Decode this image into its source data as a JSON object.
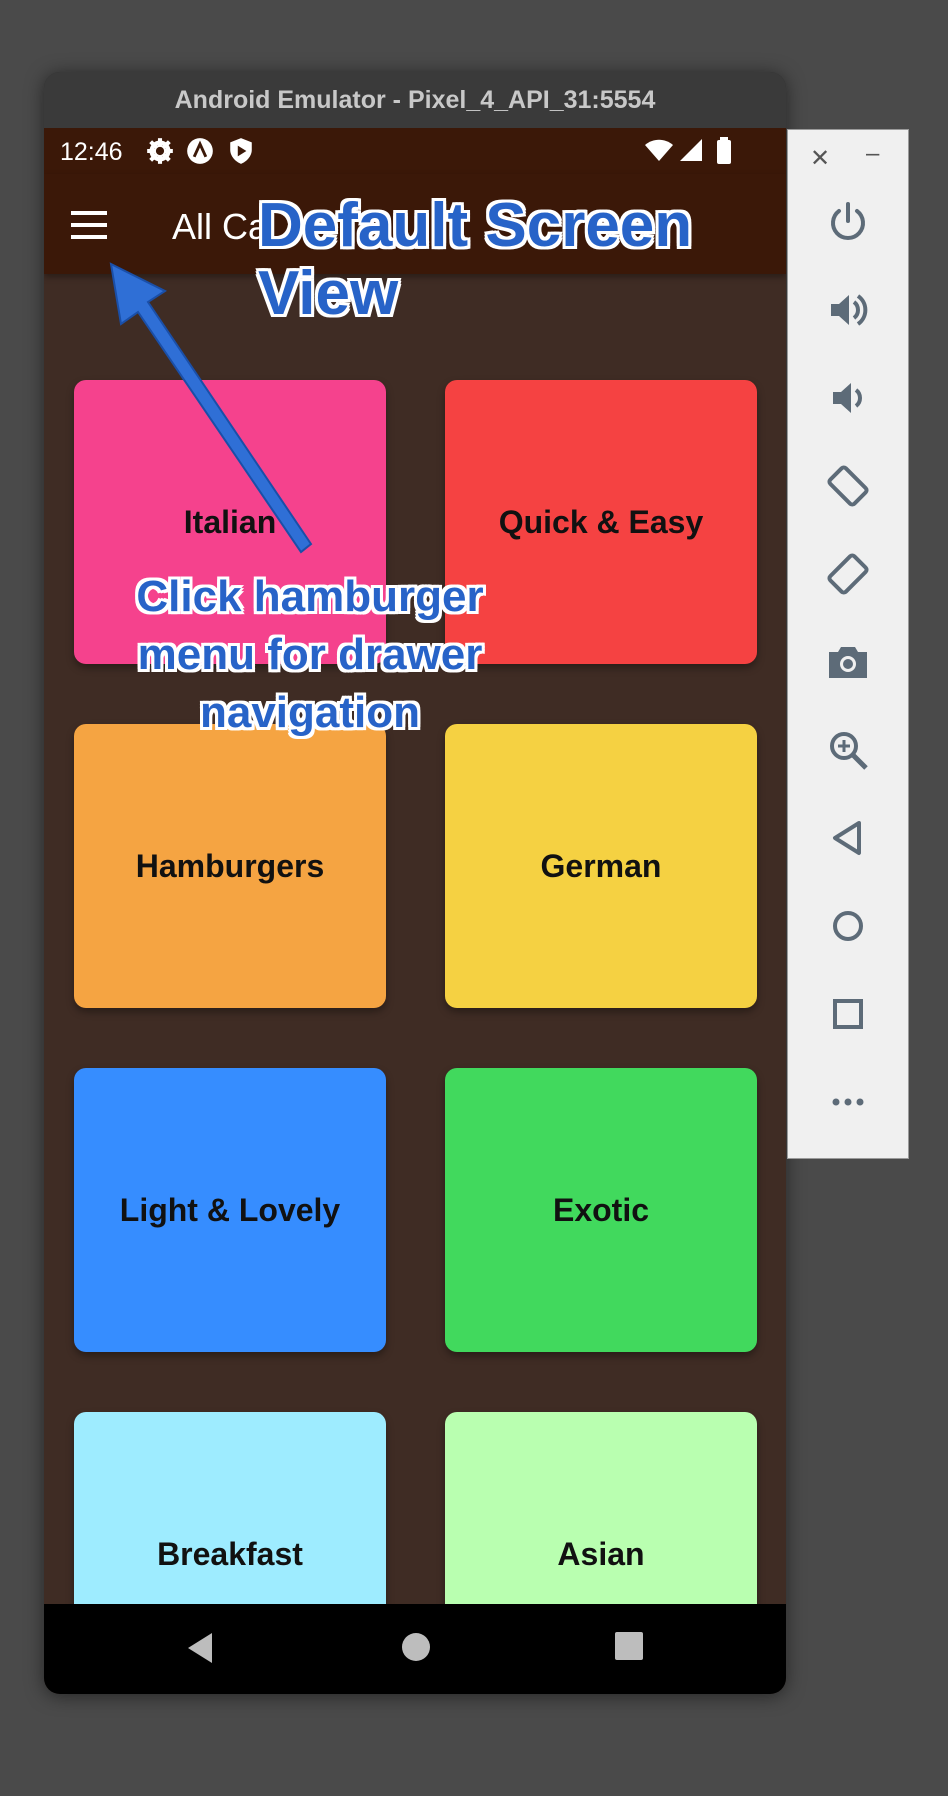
{
  "window": {
    "title": "Android Emulator - Pixel_4_API_31:5554"
  },
  "status_bar": {
    "time": "12:46"
  },
  "app_bar": {
    "title": "All Ca"
  },
  "categories": [
    {
      "label": "Italian",
      "color": "#f5428d"
    },
    {
      "label": "Quick & Easy",
      "color": "#f54242"
    },
    {
      "label": "Hamburgers",
      "color": "#f5a442"
    },
    {
      "label": "German",
      "color": "#f5d142"
    },
    {
      "label": "Light & Lovely",
      "color": "#368dff"
    },
    {
      "label": "Exotic",
      "color": "#41d95d"
    },
    {
      "label": "Breakfast",
      "color": "#9eecff"
    },
    {
      "label": "Asian",
      "color": "#b9ffb0"
    }
  ],
  "annotations": {
    "title_line1": "Default Screen",
    "title_line2": "View",
    "hint_line1": "Click hamburger",
    "hint_line2": "menu for drawer",
    "hint_line3": "navigation"
  },
  "emulator_toolbar": {
    "items": [
      "power-icon",
      "volume-up-icon",
      "volume-down-icon",
      "rotate-left-icon",
      "rotate-right-icon",
      "camera-icon",
      "zoom-icon",
      "back-icon",
      "home-icon",
      "overview-icon",
      "more-icon"
    ]
  },
  "colors": {
    "app_bar": "#3b1808",
    "background": "#3f2c24",
    "annotation": "#2763c8"
  }
}
